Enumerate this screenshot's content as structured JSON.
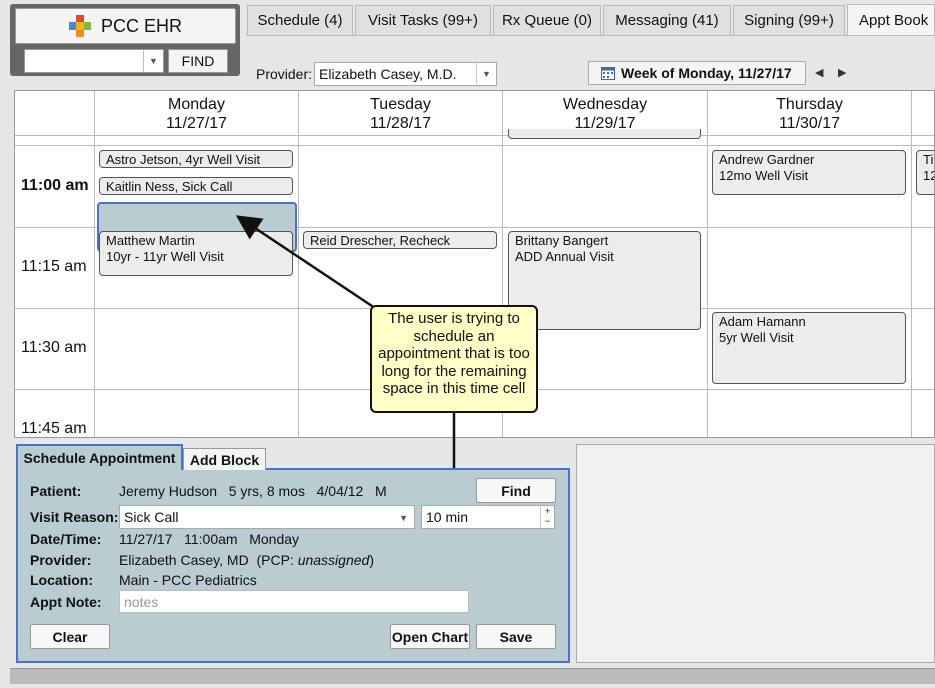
{
  "app": {
    "logo_text": "PCC EHR",
    "find_label": "FIND",
    "find_value": ""
  },
  "tabs": [
    {
      "label": "Schedule (4)"
    },
    {
      "label": "Visit Tasks (99+)"
    },
    {
      "label": "Rx Queue (0)"
    },
    {
      "label": "Messaging (41)"
    },
    {
      "label": "Signing (99+)"
    },
    {
      "label": "Appt Book"
    }
  ],
  "toolbar": {
    "provider_label": "Provider:",
    "provider_value": "Elizabeth Casey, M.D.",
    "week_label": "Week of Monday, 11/27/17",
    "prev_icon": "◀",
    "next_icon": "▶"
  },
  "calendar": {
    "days": [
      {
        "name": "Monday",
        "date": "11/27/17"
      },
      {
        "name": "Tuesday",
        "date": "11/28/17"
      },
      {
        "name": "Wednesday",
        "date": "11/29/17"
      },
      {
        "name": "Thursday",
        "date": "11/30/17"
      }
    ],
    "times": [
      "11:00 am",
      "11:15 am",
      "11:30 am",
      "11:45 am"
    ],
    "appointments": [
      {
        "line1": "Astro Jetson, 4yr Well Visit",
        "line2": ""
      },
      {
        "line1": "Kaitlin Ness, Sick Call",
        "line2": ""
      },
      {
        "line1": "Matthew Martin",
        "line2": "10yr - 11yr Well Visit"
      },
      {
        "line1": "Reid Drescher, Recheck",
        "line2": ""
      },
      {
        "line1": "Brittany Bangert",
        "line2": "ADD Annual Visit"
      },
      {
        "line1": "Andrew Gardner",
        "line2": "12mo Well Visit"
      },
      {
        "line1": "Adam Hamann",
        "line2": "5yr Well Visit"
      },
      {
        "line1": "Ti",
        "line2": "12"
      }
    ]
  },
  "callout": {
    "text": "The user is trying to schedule an appointment that is too long for the remaining space in this time cell"
  },
  "form": {
    "tab_schedule": "Schedule Appointment",
    "tab_block": "Add Block",
    "patient_label": "Patient:",
    "patient_value": "Jeremy Hudson   5 yrs, 8 mos   4/04/12   M",
    "find_button": "Find",
    "reason_label": "Visit Reason:",
    "reason_value": "Sick Call",
    "duration_value": "10 min",
    "datetime_label": "Date/Time:",
    "datetime_value": "11/27/17   11:00am   Monday",
    "provider_label": "Provider:",
    "provider_value": "Elizabeth Casey, MD",
    "pcp_prefix": "(PCP: ",
    "pcp_value": "unassigned",
    "pcp_suffix": ")",
    "location_label": "Location:",
    "location_value": "Main - PCC Pediatrics",
    "note_label": "Appt Note:",
    "note_placeholder": "notes",
    "clear_button": "Clear",
    "open_chart_button": "Open Chart",
    "save_button": "Save"
  }
}
